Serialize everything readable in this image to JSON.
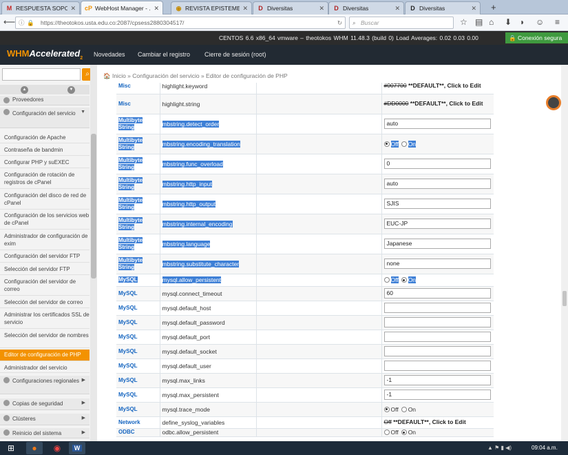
{
  "browser": {
    "tabs": [
      {
        "label": "RESPUESTA SOPORT...",
        "favicon": "M",
        "active": false
      },
      {
        "label": "WebHost Manager - ...",
        "favicon": "cP",
        "active": true
      },
      {
        "label": "REVISTA EPISTEME",
        "favicon": "◉",
        "active": false
      },
      {
        "label": "Diversitas",
        "favicon": "D",
        "active": false
      },
      {
        "label": "Diversitas",
        "favicon": "D",
        "active": false
      },
      {
        "label": "Diversitas",
        "favicon": "D",
        "active": false
      }
    ],
    "url": "https://theotokos.usta.edu.co:2087/cpsess2880304517/",
    "search_placeholder": "Buscar"
  },
  "status": {
    "info": "CENTOS 6.6 x86_64 vmware – theotokos    WHM 11.48.3 (build 0)    Load Averages: 0.02 0.03 0.00",
    "secure": "Conexión segura"
  },
  "header": {
    "logo_whm": "WHM",
    "logo_accelerated": "Accelerated",
    "logo_version": "2",
    "nav": [
      "Novedades",
      "Cambiar el registro",
      "Cierre de sesión (root)"
    ]
  },
  "sidebar": {
    "section_proveedores": "Proveedores",
    "section_config": "Configuración del servicio",
    "items": [
      "Configuración de Apache",
      "Contraseña de bandmin",
      "Configurar PHP y suEXEC",
      "Configuración de rotación de registros de cPanel",
      "Configuración del disco de red de cPanel",
      "Configuración de los servicios web de cPanel",
      "Administrador de configuración de exim",
      "Configuración del servidor FTP",
      "Selección del servidor FTP",
      "Configuración del servidor de correo",
      "Selección del servidor de correo",
      "Administrar los certificados SSL de servicio",
      "Selección del servidor de nombres",
      "Editor de configuración de PHP",
      "Administrador del servicio"
    ],
    "sections_after": [
      "Configuraciones regionales",
      "Copias de seguridad",
      "Clústeres",
      "Reinicio del sistema"
    ]
  },
  "breadcrumb": "Inicio » Configuración del servicio » Editor de configuración de PHP",
  "rows": [
    {
      "section": "Misc",
      "directive": "highlight.keyword",
      "type": "default",
      "value": "#007700",
      "default_label": "**DEFAULT**, Click to Edit",
      "highlight": false
    },
    {
      "section": "Misc",
      "directive": "highlight.string",
      "type": "default",
      "value": "#DD0000",
      "default_label": "**DEFAULT**, Click to Edit",
      "highlight": false
    },
    {
      "section": "Multibyte String",
      "directive": "mbstring.detect_order",
      "type": "text",
      "value": "auto",
      "highlight": true
    },
    {
      "section": "Multibyte String",
      "directive": "mbstring.encoding_translation",
      "type": "radio",
      "off": "Off",
      "on": "On",
      "selected": "Off",
      "highlight": true
    },
    {
      "section": "Multibyte String",
      "directive": "mbstring.func_overload",
      "type": "text",
      "value": "0",
      "highlight": true
    },
    {
      "section": "Multibyte String",
      "directive": "mbstring.http_input",
      "type": "text",
      "value": "auto",
      "highlight": true
    },
    {
      "section": "Multibyte String",
      "directive": "mbstring.http_output",
      "type": "text",
      "value": "SJIS",
      "highlight": true
    },
    {
      "section": "Multibyte String",
      "directive": "mbstring.internal_encoding",
      "type": "text",
      "value": "EUC-JP",
      "highlight": true
    },
    {
      "section": "Multibyte String",
      "directive": "mbstring.language",
      "type": "text",
      "value": "Japanese",
      "highlight": true
    },
    {
      "section": "Multibyte String",
      "directive": "mbstring.substitute_character",
      "type": "text",
      "value": "none",
      "highlight": true
    },
    {
      "section": "MySQL",
      "directive": "mysql.allow_persistent",
      "type": "radio",
      "off": "Off",
      "on": "On",
      "selected": "On",
      "highlight": true
    },
    {
      "section": "MySQL",
      "directive": "mysql.connect_timeout",
      "type": "text",
      "value": "60",
      "highlight": false
    },
    {
      "section": "MySQL",
      "directive": "mysql.default_host",
      "type": "text",
      "value": "",
      "highlight": false
    },
    {
      "section": "MySQL",
      "directive": "mysql.default_password",
      "type": "text",
      "value": "",
      "highlight": false
    },
    {
      "section": "MySQL",
      "directive": "mysql.default_port",
      "type": "text",
      "value": "",
      "highlight": false
    },
    {
      "section": "MySQL",
      "directive": "mysql.default_socket",
      "type": "text",
      "value": "",
      "highlight": false
    },
    {
      "section": "MySQL",
      "directive": "mysql.default_user",
      "type": "text",
      "value": "",
      "highlight": false
    },
    {
      "section": "MySQL",
      "directive": "mysql.max_links",
      "type": "text",
      "value": "-1",
      "highlight": false
    },
    {
      "section": "MySQL",
      "directive": "mysql.max_persistent",
      "type": "text",
      "value": "-1",
      "highlight": false
    },
    {
      "section": "MySQL",
      "directive": "mysql.trace_mode",
      "type": "radio",
      "off": "Off",
      "on": "On",
      "selected": "Off",
      "highlight": false
    },
    {
      "section": "Network",
      "directive": "define_syslog_variables",
      "type": "default",
      "value": "Off",
      "default_label": "**DEFAULT**, Click to Edit",
      "highlight": false
    },
    {
      "section": "ODBC",
      "directive": "odbc.allow_persistent",
      "type": "radio",
      "off": "Off",
      "on": "On",
      "selected": "On",
      "highlight": false
    }
  ],
  "taskbar": {
    "clock": "09:04 a.m."
  },
  "colors": {
    "accent": "#f39200",
    "section_blue": "#1565c0",
    "highlight": "#3d7fd6",
    "header_bg": "#222a33"
  }
}
